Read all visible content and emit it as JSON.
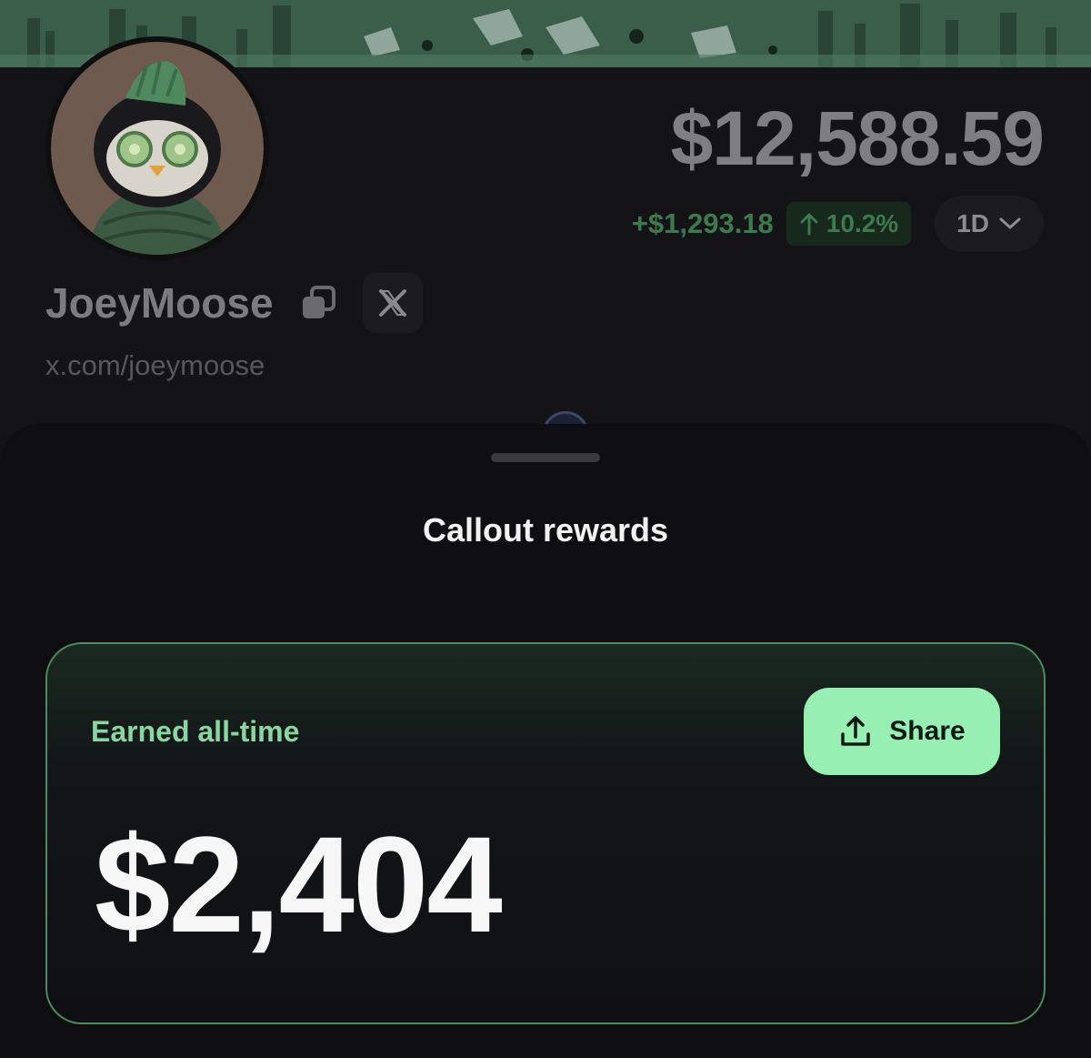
{
  "profile": {
    "balance": "$12,588.59",
    "change_value": "+$1,293.18",
    "change_pct": "10.2%",
    "period": "1D",
    "username": "JoeyMoose",
    "link": "x.com/joeymoose"
  },
  "sheet": {
    "title": "Callout rewards",
    "card": {
      "label": "Earned all-time",
      "share_label": "Share",
      "value": "$2,404"
    }
  },
  "colors": {
    "accent_green": "#98efb4",
    "label_green": "#8ad6a2",
    "positive_change": "#3e7a4f"
  }
}
